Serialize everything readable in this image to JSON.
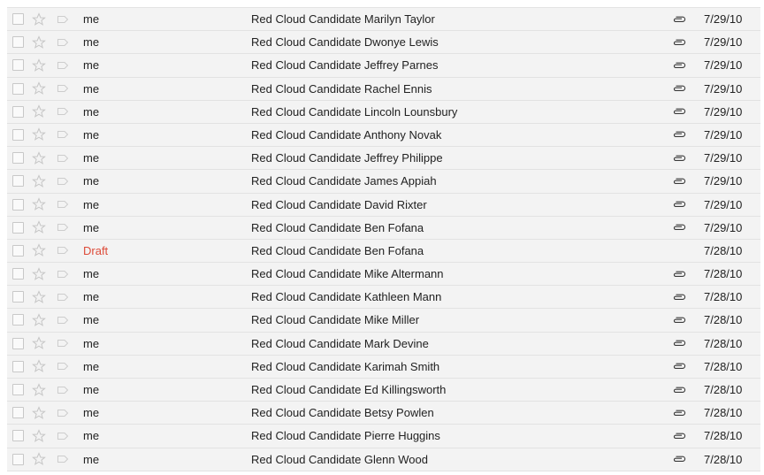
{
  "rows": [
    {
      "sender": "me",
      "subject": "Red Cloud Candidate Marilyn Taylor",
      "date": "7/29/10",
      "attachment": true,
      "draft": false
    },
    {
      "sender": "me",
      "subject": "Red Cloud Candidate Dwonye Lewis",
      "date": "7/29/10",
      "attachment": true,
      "draft": false
    },
    {
      "sender": "me",
      "subject": "Red Cloud Candidate Jeffrey Parnes",
      "date": "7/29/10",
      "attachment": true,
      "draft": false
    },
    {
      "sender": "me",
      "subject": "Red Cloud Candidate Rachel Ennis",
      "date": "7/29/10",
      "attachment": true,
      "draft": false
    },
    {
      "sender": "me",
      "subject": "Red Cloud Candidate Lincoln Lounsbury",
      "date": "7/29/10",
      "attachment": true,
      "draft": false
    },
    {
      "sender": "me",
      "subject": "Red Cloud Candidate Anthony Novak",
      "date": "7/29/10",
      "attachment": true,
      "draft": false
    },
    {
      "sender": "me",
      "subject": "Red Cloud Candidate Jeffrey Philippe",
      "date": "7/29/10",
      "attachment": true,
      "draft": false
    },
    {
      "sender": "me",
      "subject": "Red Cloud Candidate James Appiah",
      "date": "7/29/10",
      "attachment": true,
      "draft": false
    },
    {
      "sender": "me",
      "subject": "Red Cloud Candidate David Rixter",
      "date": "7/29/10",
      "attachment": true,
      "draft": false
    },
    {
      "sender": "me",
      "subject": "Red Cloud Candidate Ben Fofana",
      "date": "7/29/10",
      "attachment": true,
      "draft": false
    },
    {
      "sender": "Draft",
      "subject": "Red Cloud Candidate Ben Fofana",
      "date": "7/28/10",
      "attachment": false,
      "draft": true
    },
    {
      "sender": "me",
      "subject": "Red Cloud Candidate Mike Altermann",
      "date": "7/28/10",
      "attachment": true,
      "draft": false
    },
    {
      "sender": "me",
      "subject": "Red Cloud Candidate Kathleen Mann",
      "date": "7/28/10",
      "attachment": true,
      "draft": false
    },
    {
      "sender": "me",
      "subject": "Red Cloud Candidate Mike Miller",
      "date": "7/28/10",
      "attachment": true,
      "draft": false
    },
    {
      "sender": "me",
      "subject": "Red Cloud Candidate Mark Devine",
      "date": "7/28/10",
      "attachment": true,
      "draft": false
    },
    {
      "sender": "me",
      "subject": "Red Cloud Candidate Karimah Smith",
      "date": "7/28/10",
      "attachment": true,
      "draft": false
    },
    {
      "sender": "me",
      "subject": "Red Cloud Candidate Ed Killingsworth",
      "date": "7/28/10",
      "attachment": true,
      "draft": false
    },
    {
      "sender": "me",
      "subject": "Red Cloud Candidate Betsy Powlen",
      "date": "7/28/10",
      "attachment": true,
      "draft": false
    },
    {
      "sender": "me",
      "subject": "Red Cloud Candidate Pierre Huggins",
      "date": "7/28/10",
      "attachment": true,
      "draft": false
    },
    {
      "sender": "me",
      "subject": "Red Cloud Candidate Glenn Wood",
      "date": "7/28/10",
      "attachment": true,
      "draft": false
    }
  ],
  "icons": {
    "checkbox": "checkbox-icon",
    "star": "star-icon",
    "label": "label-tag-icon",
    "attachment": "paperclip-icon"
  },
  "colors": {
    "draft": "#dd4b39",
    "row_bg": "#f3f3f3",
    "row_border": "#e2e2e2"
  }
}
